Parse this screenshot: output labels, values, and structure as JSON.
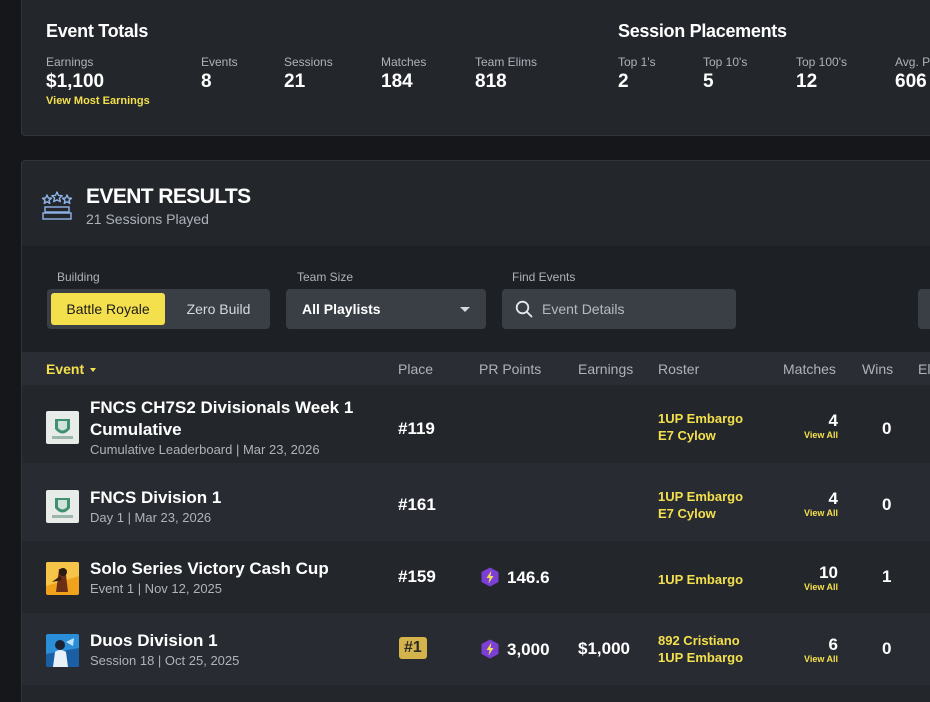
{
  "totals": {
    "title": "Event Totals",
    "stats": [
      {
        "label": "Earnings",
        "value": "$1,100",
        "link": "View Most Earnings"
      },
      {
        "label": "Events",
        "value": "8"
      },
      {
        "label": "Sessions",
        "value": "21"
      },
      {
        "label": "Matches",
        "value": "184"
      },
      {
        "label": "Team Elims",
        "value": "818"
      }
    ]
  },
  "placements": {
    "title": "Session Placements",
    "stats": [
      {
        "label": "Top 1's",
        "value": "2"
      },
      {
        "label": "Top 10's",
        "value": "5"
      },
      {
        "label": "Top 100's",
        "value": "12"
      },
      {
        "label": "Avg. P",
        "value": "606"
      }
    ]
  },
  "results": {
    "title": "EVENT RESULTS",
    "subtitle": "21 Sessions Played",
    "icon": "trophy-stars-icon"
  },
  "filters": {
    "building_label": "Building",
    "building_options": [
      "Battle Royale",
      "Zero Build"
    ],
    "building_selected": "Battle Royale",
    "team_size_label": "Team Size",
    "team_size_value": "All Playlists",
    "find_label": "Find Events",
    "find_placeholder": "Event Details"
  },
  "table": {
    "columns": [
      "Event",
      "Place",
      "PR Points",
      "Earnings",
      "Roster",
      "Matches",
      "Wins",
      "El"
    ],
    "rows": [
      {
        "title_lines": [
          "FNCS CH7S2 Divisionals Week 1",
          "Cumulative"
        ],
        "meta": "Cumulative Leaderboard | Mar 23, 2026",
        "thumb": "fncs-logo",
        "place": "#119",
        "place_highlight": false,
        "pr_points": "",
        "earnings": "",
        "roster": [
          "1UP Embargo",
          "E7 Cylow"
        ],
        "matches": "4",
        "matches_link": "View All",
        "wins": "0"
      },
      {
        "title_lines": [
          "FNCS Division 1"
        ],
        "meta": "Day 1 | Mar 23, 2026",
        "thumb": "fncs-logo",
        "place": "#161",
        "place_highlight": false,
        "pr_points": "",
        "earnings": "",
        "roster": [
          "1UP Embargo",
          "E7 Cylow"
        ],
        "matches": "4",
        "matches_link": "View All",
        "wins": "0"
      },
      {
        "title_lines": [
          "Solo Series Victory Cash Cup"
        ],
        "meta": "Event 1 | Nov 12, 2025",
        "thumb": "cash-cup-art",
        "place": "#159",
        "place_highlight": false,
        "pr_points": "146.6",
        "earnings": "",
        "roster": [
          "1UP Embargo"
        ],
        "matches": "10",
        "matches_link": "View All",
        "wins": "1"
      },
      {
        "title_lines": [
          "Duos Division 1"
        ],
        "meta": "Session 18 | Oct 25, 2025",
        "thumb": "duos-art",
        "place": "#1",
        "place_highlight": true,
        "pr_points": "3,000",
        "earnings": "$1,000",
        "roster": [
          "892 Cristiano",
          "1UP Embargo"
        ],
        "matches": "6",
        "matches_link": "View All",
        "wins": "0"
      }
    ]
  },
  "colors": {
    "accent": "#f4e04d",
    "card": "#23272c",
    "pr_icon": "#7b3fd6",
    "place_badge": "#d4b24c"
  }
}
